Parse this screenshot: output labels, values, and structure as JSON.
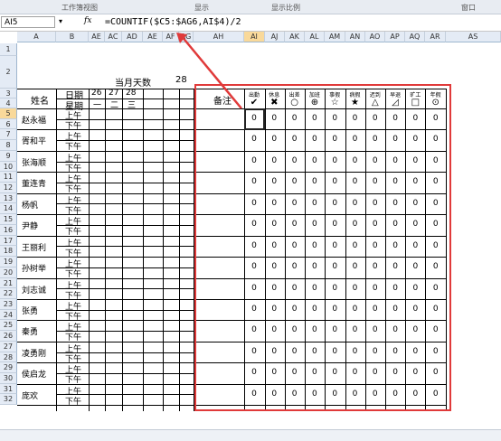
{
  "ribbon": {
    "group1": "工作簿视图",
    "group2": "显示",
    "group3": "显示比例",
    "group4": "窗口"
  },
  "formula_bar": {
    "name_box": "AI5",
    "fx": "fx",
    "formula": "=COUNTIF($C5:$AG6,AI$4)/2"
  },
  "columns": [
    "A",
    "B",
    "AE",
    "AC",
    "AD",
    "AE",
    "AF",
    "AG",
    "AH",
    "AI",
    "AJ",
    "AK",
    "AL",
    "AM",
    "AN",
    "AO",
    "AP",
    "AQ",
    "AR",
    "AS"
  ],
  "rows": [
    "1",
    "2",
    "3",
    "4",
    "5",
    "6",
    "7",
    "8",
    "9",
    "10",
    "11",
    "12",
    "13",
    "14",
    "15",
    "16",
    "17",
    "18",
    "19",
    "20",
    "21",
    "22",
    "23",
    "24",
    "25",
    "26",
    "27",
    "28",
    "29",
    "30",
    "31",
    "32"
  ],
  "sheet": {
    "month_days_label": "当月天数",
    "month_days_value": "28",
    "name_header": "姓名",
    "date_header": "日期",
    "week_header": "星期",
    "dates": [
      "26",
      "27",
      "28"
    ],
    "weekdays": [
      "一",
      "二",
      "三"
    ],
    "remark_header": "备注",
    "am": "上午",
    "pm": "下午",
    "employees": [
      "赵永福",
      "胥和平",
      "张海顺",
      "董连青",
      "杨帆",
      "尹静",
      "王丽利",
      "孙树举",
      "刘志诚",
      "张勇",
      "秦勇",
      "凌勇刚",
      "侯启龙",
      "庞欢"
    ],
    "stat_labels": [
      "出勤",
      "休息",
      "出差",
      "加班",
      "事假",
      "病假",
      "迟到",
      "早退",
      "旷工",
      "年假"
    ],
    "stat_symbols": [
      "✔",
      "✖",
      "○",
      "⊕",
      "☆",
      "★",
      "△",
      "◿",
      "□",
      "⊙"
    ],
    "zero": "0"
  }
}
